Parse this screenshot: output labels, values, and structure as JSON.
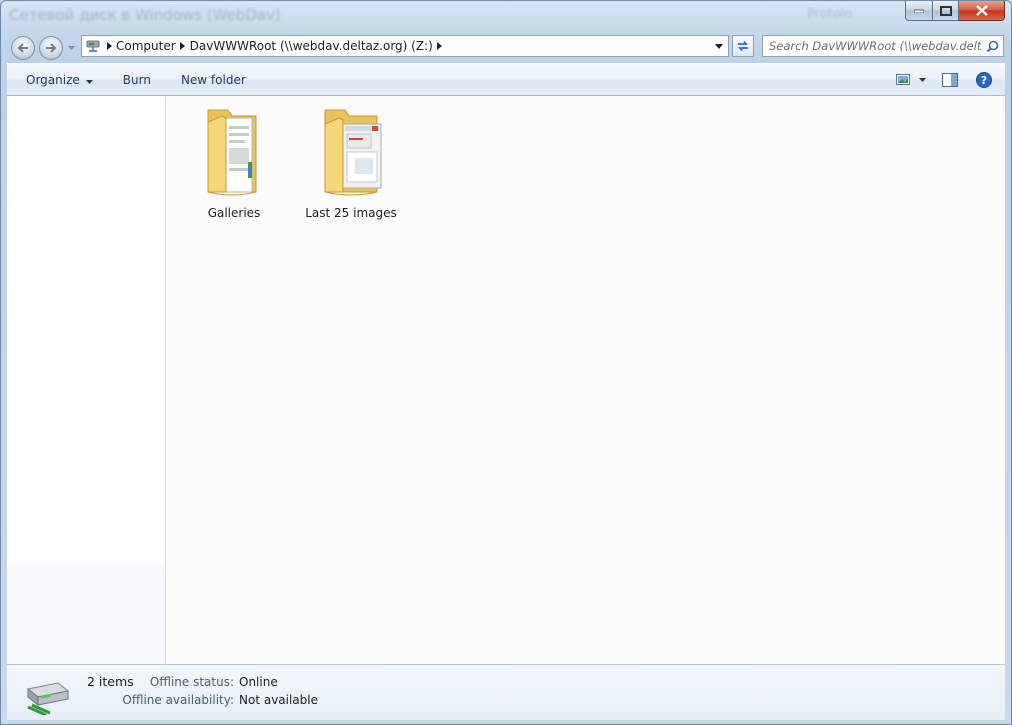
{
  "window": {
    "title": "Сетевой диск в Windows (WebDav)",
    "ghost_text": "Protolo"
  },
  "navigation": {
    "breadcrumbs": [
      {
        "label": "Computer"
      },
      {
        "label": "DavWWWRoot (\\\\webdav.deltaz.org) (Z:)"
      }
    ],
    "search_placeholder": "Search DavWWWRoot (\\\\webdav.delt..."
  },
  "toolbar": {
    "organize_label": "Organize",
    "burn_label": "Burn",
    "new_folder_label": "New folder"
  },
  "items": [
    {
      "name": "Galleries"
    },
    {
      "name": "Last 25 images"
    }
  ],
  "details": {
    "item_count": "2 items",
    "offline_status_label": "Offline status:",
    "offline_status_value": "Online",
    "offline_availability_label": "Offline availability:",
    "offline_availability_value": "Not available"
  },
  "colors": {
    "window_frame": "#c6d8ea",
    "command_text": "#1e395b",
    "close_button": "#c0331a",
    "folder_yellow": "#f5d77a"
  },
  "icons": [
    "back-icon",
    "forward-icon",
    "network-drive-icon",
    "refresh-icon",
    "search-icon",
    "change-view-icon",
    "preview-pane-icon",
    "help-icon",
    "folder-icon",
    "drive-icon"
  ]
}
